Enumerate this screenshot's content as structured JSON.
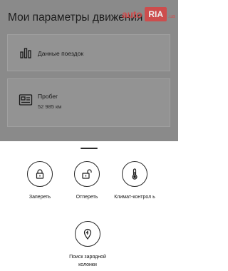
{
  "background_screen": {
    "title": "Мои параметры движения",
    "cards": [
      {
        "label": "Данные поездок",
        "icon": "bar-chart-icon"
      },
      {
        "label": "Пробег",
        "value": "52 985 км",
        "icon": "odometer-icon"
      }
    ]
  },
  "watermark": {
    "brand_left": "auto",
    "brand_right": "RIA",
    "suffix": ".ua"
  },
  "sheet": {
    "actions": [
      {
        "label": "Запереть",
        "icon": "lock-icon"
      },
      {
        "label": "Отпереть",
        "icon": "unlock-icon"
      },
      {
        "label": "Климат-контрол ь",
        "icon": "thermometer-icon"
      },
      {
        "label": "Поиск зарядной колонки",
        "icon": "location-pin-icon"
      }
    ]
  }
}
